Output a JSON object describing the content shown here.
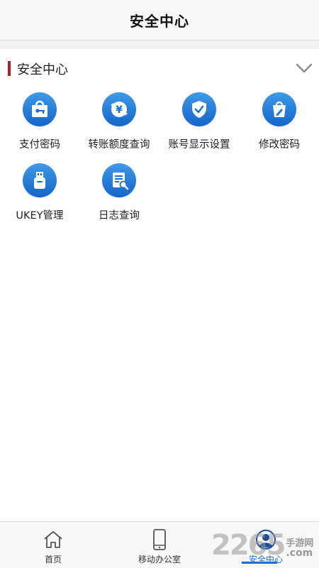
{
  "header": {
    "title": "安全中心"
  },
  "section": {
    "title": "安全中心",
    "accent_color": "#b3202a"
  },
  "items": [
    {
      "label": "支付密码",
      "icon": "key-bag-icon"
    },
    {
      "label": "转账额度查询",
      "icon": "yen-transfer-icon"
    },
    {
      "label": "账号显示设置",
      "icon": "shield-check-icon"
    },
    {
      "label": "修改密码",
      "icon": "pen-bag-icon"
    },
    {
      "label": "UKEY管理",
      "icon": "usb-key-icon"
    },
    {
      "label": "日志查询",
      "icon": "log-search-icon"
    }
  ],
  "tabbar": {
    "tabs": [
      {
        "label": "首页",
        "icon": "home-icon",
        "active": false
      },
      {
        "label": "移动办公室",
        "icon": "phone-icon",
        "active": false
      },
      {
        "label": "安全中心",
        "icon": "user-icon",
        "active": true
      }
    ],
    "active_color": "#1a6fd6"
  },
  "watermark": {
    "number": "2265",
    "line1": "手游网",
    "line2": ".com"
  }
}
